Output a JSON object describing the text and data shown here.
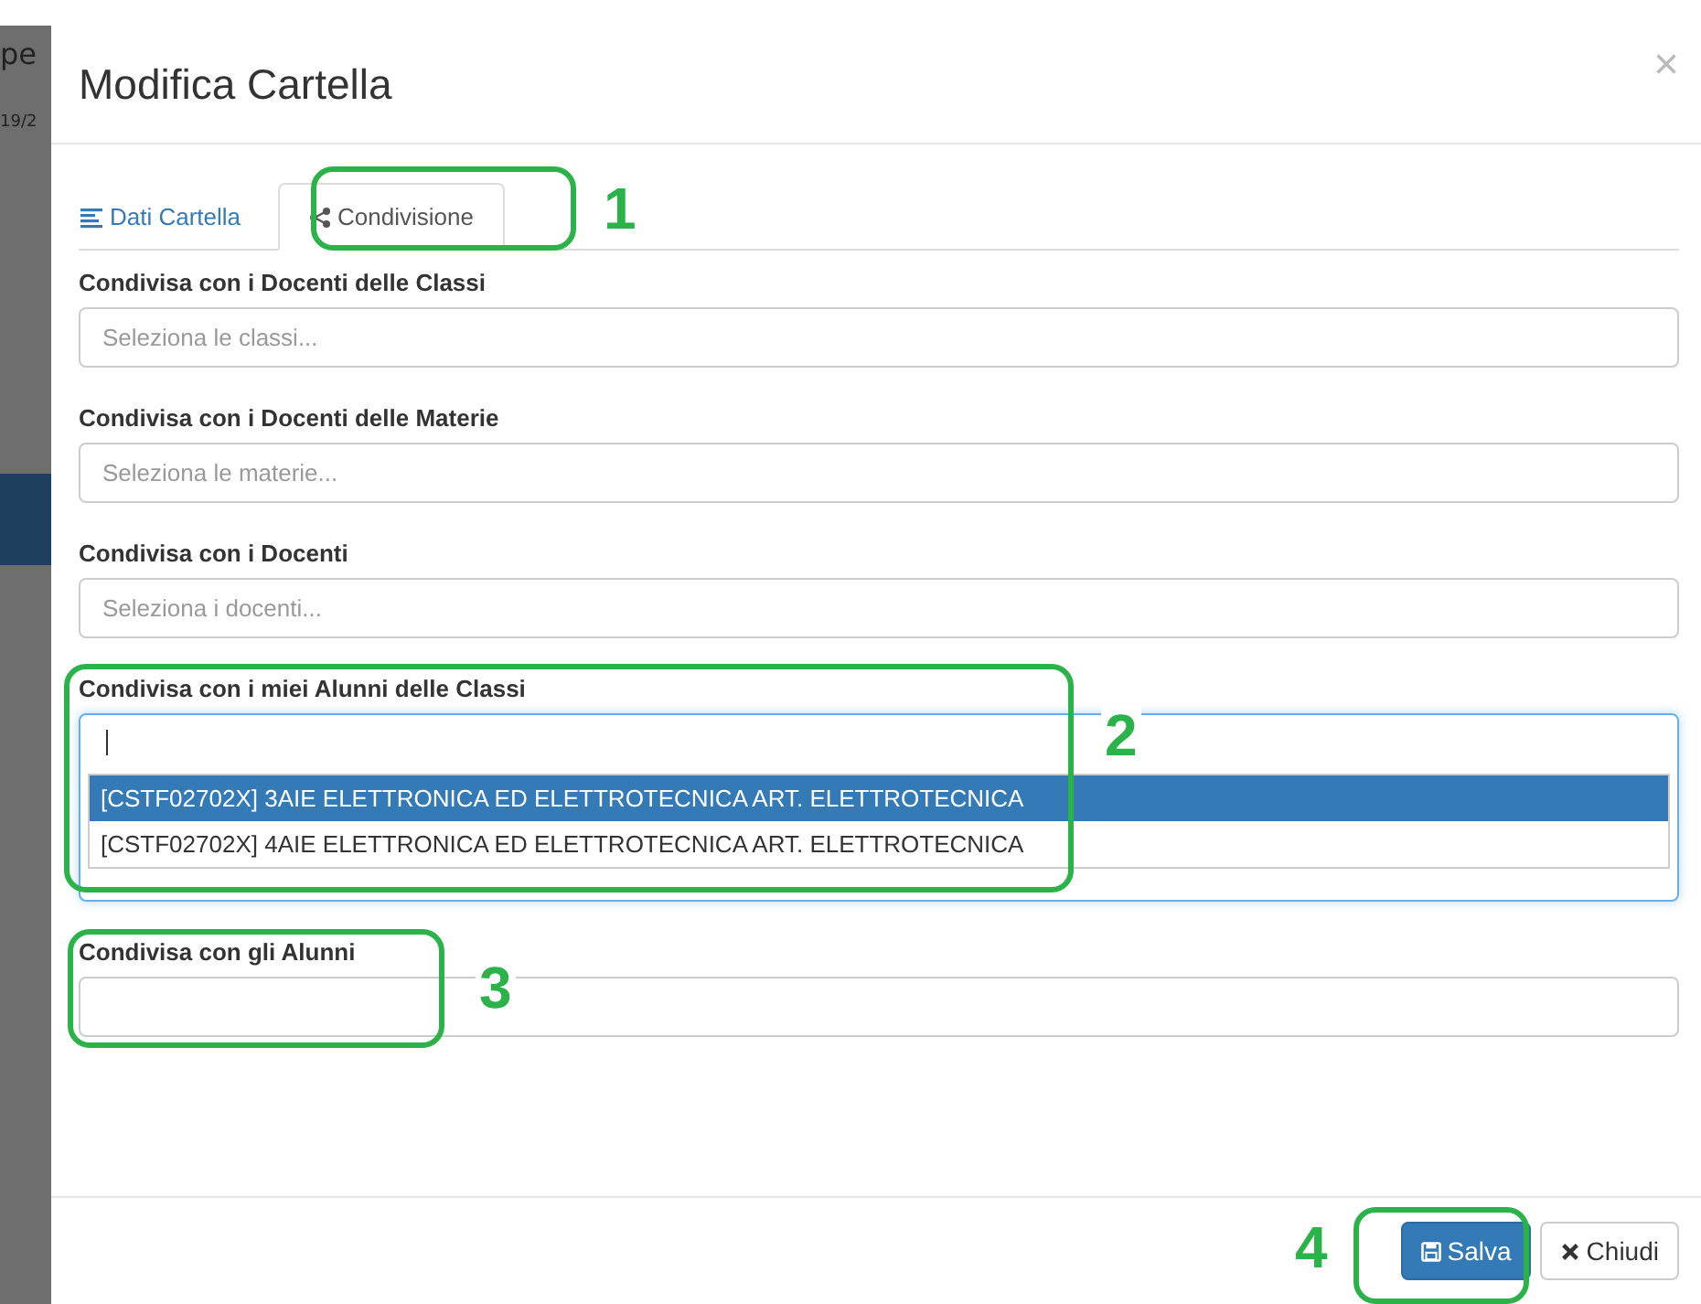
{
  "background": {
    "texts": [
      "pe",
      "19/2"
    ]
  },
  "dialog": {
    "title": "Modifica Cartella",
    "close": "×"
  },
  "tabs": [
    {
      "label": "Dati Cartella",
      "selected": false
    },
    {
      "label": "Condivisione",
      "selected": true
    }
  ],
  "fields": [
    {
      "label": "Condivisa con i Docenti delle Classi",
      "placeholder": "Seleziona le classi...",
      "focused": false
    },
    {
      "label": "Condivisa con i Docenti delle Materie",
      "placeholder": "Seleziona le materie...",
      "focused": false
    },
    {
      "label": "Condivisa con i Docenti",
      "placeholder": "Seleziona i docenti...",
      "focused": false
    },
    {
      "label": "Condivisa con i miei Alunni delle Classi",
      "focused": true,
      "options": [
        {
          "label": "[CSTF02702X] 3AIE ELETTRONICA ED ELETTROTECNICA ART. ELETTROTECNICA",
          "selected": true
        },
        {
          "label": "[CSTF02702X] 4AIE ELETTRONICA ED ELETTROTECNICA ART. ELETTROTECNICA",
          "selected": false
        }
      ]
    },
    {
      "label": "Condivisa con gli Alunni",
      "focused": false
    }
  ],
  "buttons": [
    {
      "label": "Salva",
      "kind": "primary"
    },
    {
      "label": "Chiudi",
      "kind": "default"
    }
  ],
  "annotations": [
    {
      "number": "1"
    },
    {
      "number": "2"
    },
    {
      "number": "3"
    },
    {
      "number": "4"
    }
  ]
}
